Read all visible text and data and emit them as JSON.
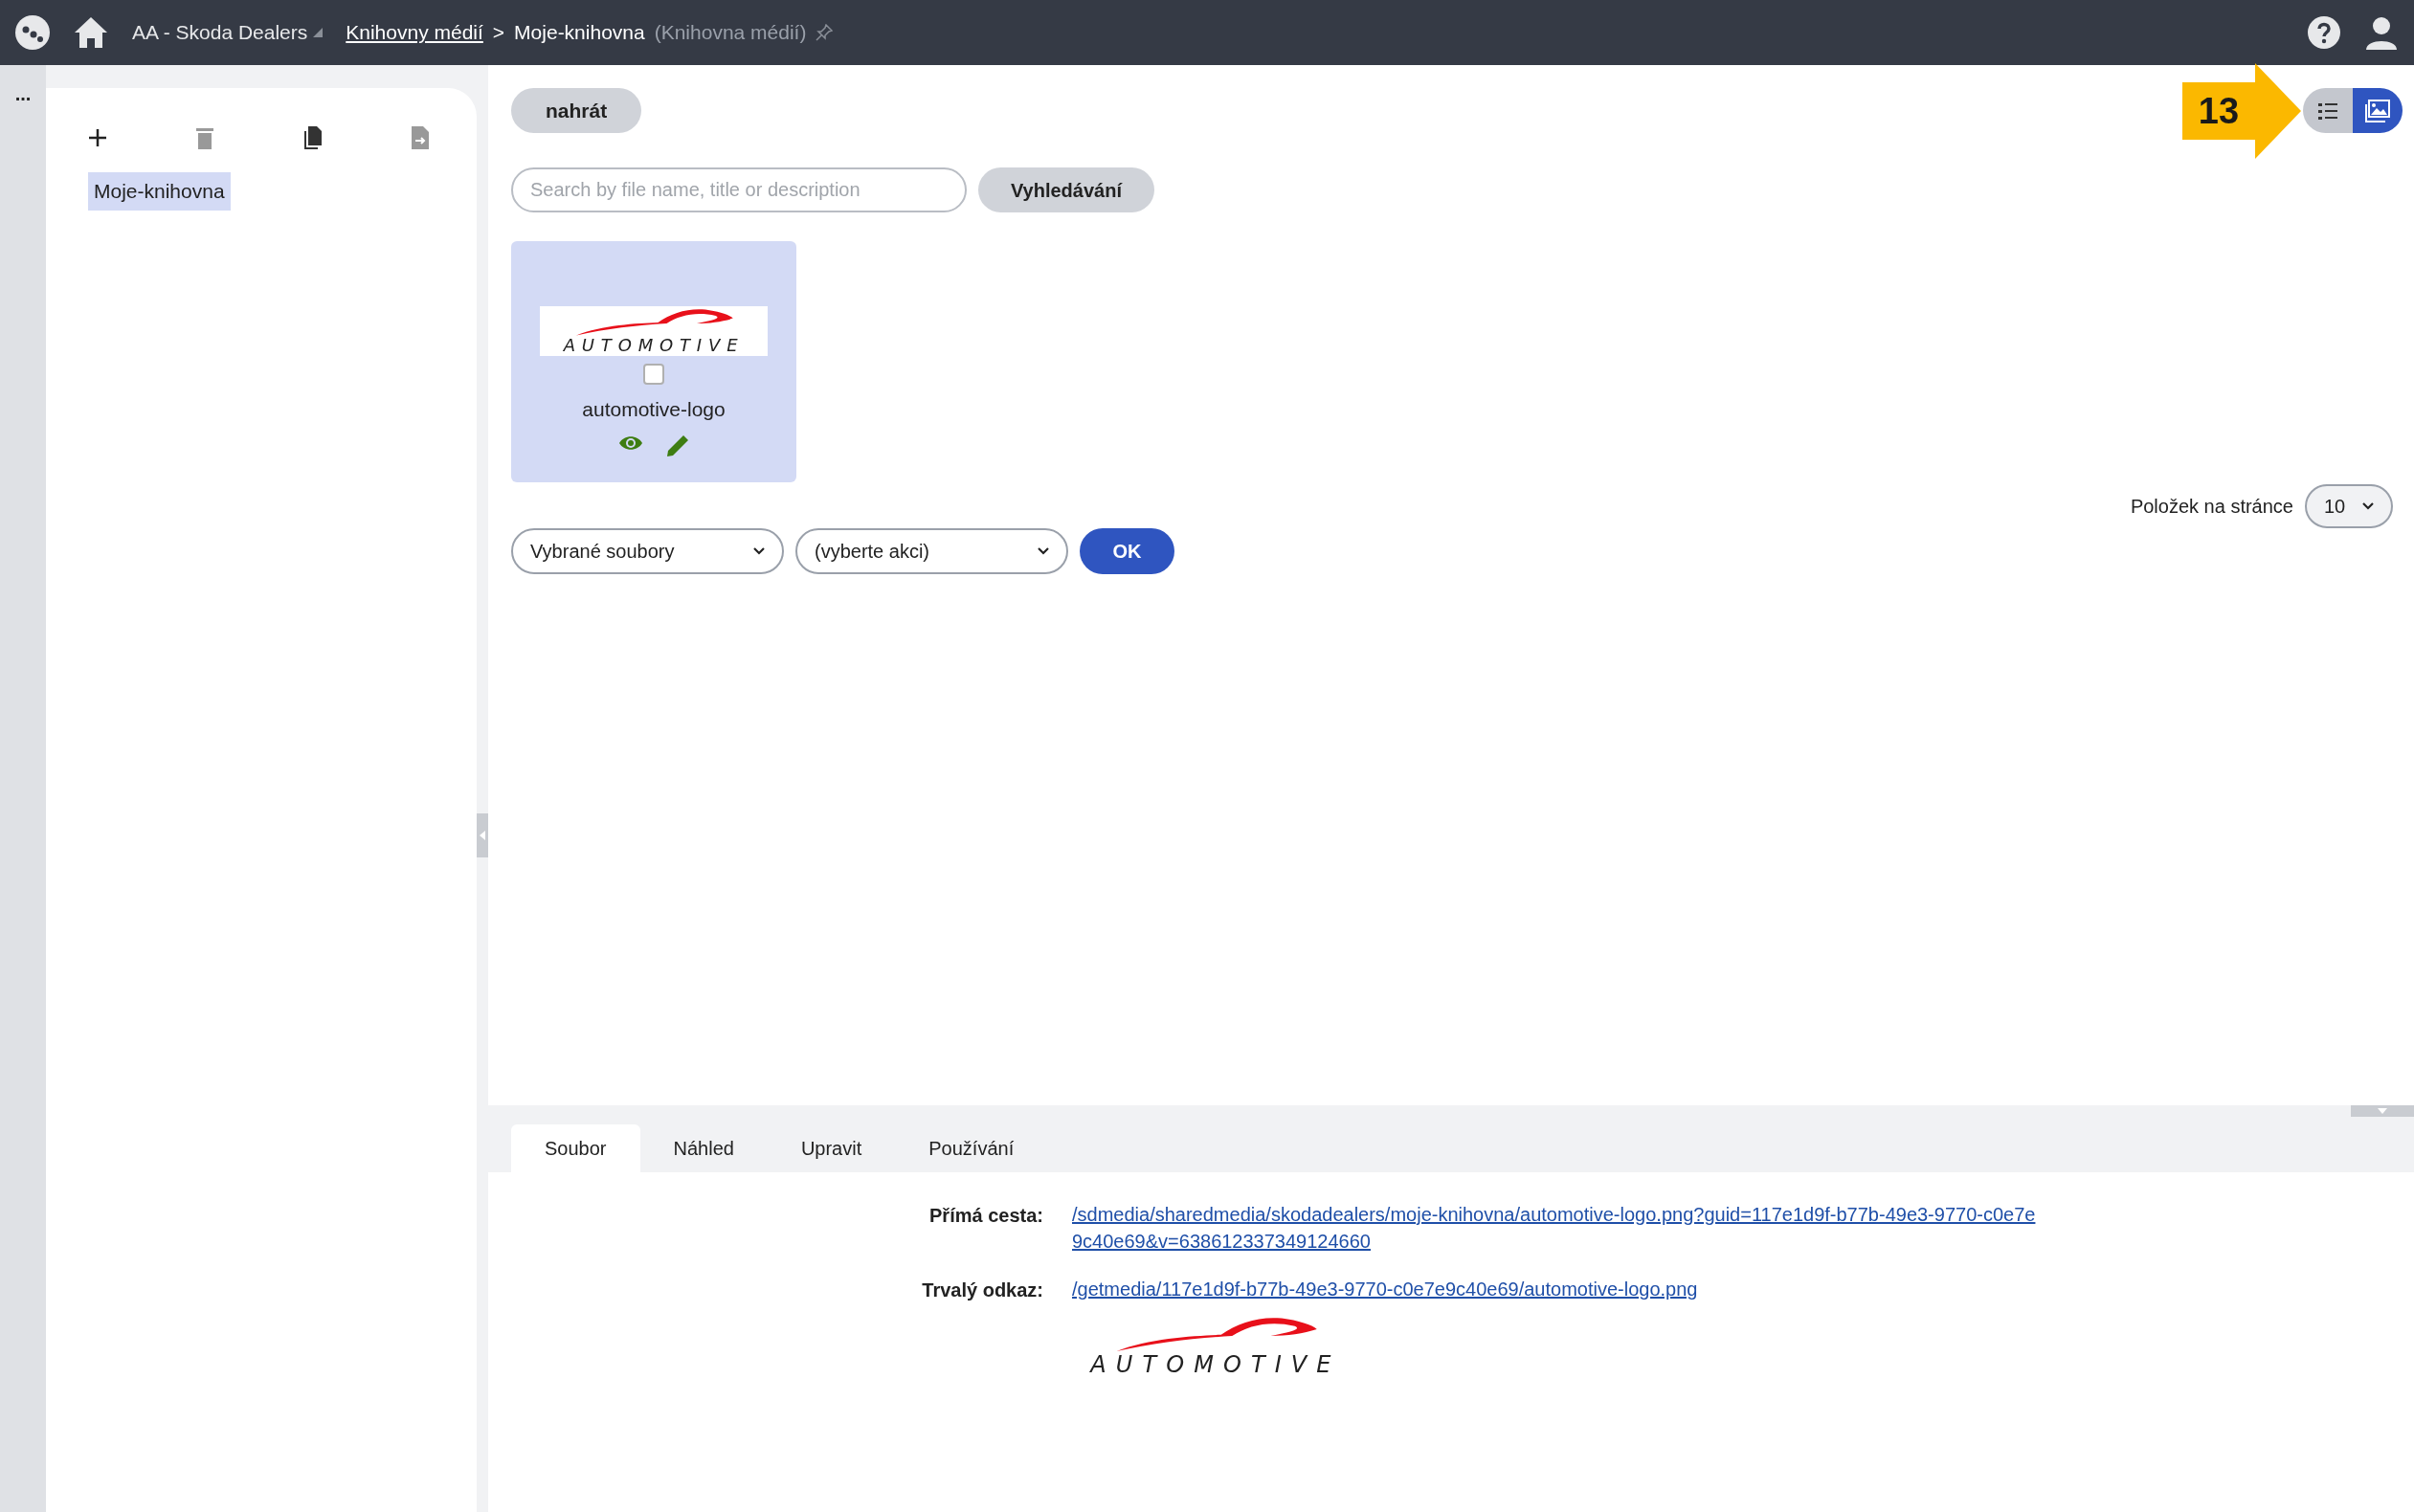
{
  "top_bar": {
    "site": "AA - Skoda Dealers",
    "breadcrumb_link": "Knihovny médií",
    "separator": ">",
    "current": "Moje-knihovna",
    "current_note": "(Knihovna médií)"
  },
  "side_strip": {
    "menu": "..."
  },
  "sidebar": {
    "tree": [
      {
        "label": "Moje-knihovna",
        "selected": true
      }
    ]
  },
  "toolbar": {
    "upload": "nahrát",
    "search_placeholder": "Search by file name, title or description",
    "search_button": "Vyhledávání",
    "view_modes": [
      {
        "kind": "list",
        "selected": false
      },
      {
        "kind": "tiles",
        "selected": true
      }
    ]
  },
  "annotation": {
    "number": "13"
  },
  "files": [
    {
      "name": "automotive-logo",
      "logo_text": "AUTOMOTIVE",
      "checked": false,
      "selected": true
    }
  ],
  "paging": {
    "label": "Položek na stránce",
    "value": "10"
  },
  "bulk": {
    "scope": "Vybrané soubory",
    "action": "(vyberte akci)",
    "ok": "OK"
  },
  "detail": {
    "tabs": [
      {
        "label": "Soubor",
        "selected": true
      },
      {
        "label": "Náhled",
        "selected": false
      },
      {
        "label": "Upravit",
        "selected": false
      },
      {
        "label": "Používání",
        "selected": false
      }
    ],
    "rows": [
      {
        "label": "Přímá cesta:",
        "link": "/sdmedia/sharedmedia/skodadealers/moje-knihovna/automotive-logo.png?guid=117e1d9f-b77b-49e3-9770-c0e7e9c40e69&v=638612337349124660"
      },
      {
        "label": "Trvalý odkaz:",
        "link": "/getmedia/117e1d9f-b77b-49e3-9770-c0e7e9c40e69/automotive-logo.png"
      }
    ],
    "preview_logo_text": "AUTOMOTIVE"
  }
}
